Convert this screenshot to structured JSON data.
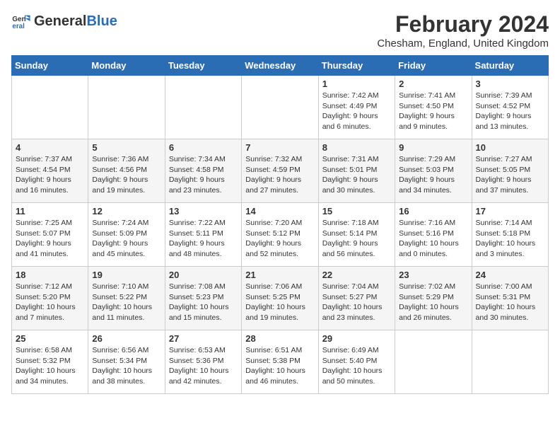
{
  "header": {
    "logo_general": "General",
    "logo_blue": "Blue",
    "month_year": "February 2024",
    "location": "Chesham, England, United Kingdom"
  },
  "days_of_week": [
    "Sunday",
    "Monday",
    "Tuesday",
    "Wednesday",
    "Thursday",
    "Friday",
    "Saturday"
  ],
  "weeks": [
    [
      {
        "day": "",
        "info": ""
      },
      {
        "day": "",
        "info": ""
      },
      {
        "day": "",
        "info": ""
      },
      {
        "day": "",
        "info": ""
      },
      {
        "day": "1",
        "info": "Sunrise: 7:42 AM\nSunset: 4:49 PM\nDaylight: 9 hours\nand 6 minutes."
      },
      {
        "day": "2",
        "info": "Sunrise: 7:41 AM\nSunset: 4:50 PM\nDaylight: 9 hours\nand 9 minutes."
      },
      {
        "day": "3",
        "info": "Sunrise: 7:39 AM\nSunset: 4:52 PM\nDaylight: 9 hours\nand 13 minutes."
      }
    ],
    [
      {
        "day": "4",
        "info": "Sunrise: 7:37 AM\nSunset: 4:54 PM\nDaylight: 9 hours\nand 16 minutes."
      },
      {
        "day": "5",
        "info": "Sunrise: 7:36 AM\nSunset: 4:56 PM\nDaylight: 9 hours\nand 19 minutes."
      },
      {
        "day": "6",
        "info": "Sunrise: 7:34 AM\nSunset: 4:58 PM\nDaylight: 9 hours\nand 23 minutes."
      },
      {
        "day": "7",
        "info": "Sunrise: 7:32 AM\nSunset: 4:59 PM\nDaylight: 9 hours\nand 27 minutes."
      },
      {
        "day": "8",
        "info": "Sunrise: 7:31 AM\nSunset: 5:01 PM\nDaylight: 9 hours\nand 30 minutes."
      },
      {
        "day": "9",
        "info": "Sunrise: 7:29 AM\nSunset: 5:03 PM\nDaylight: 9 hours\nand 34 minutes."
      },
      {
        "day": "10",
        "info": "Sunrise: 7:27 AM\nSunset: 5:05 PM\nDaylight: 9 hours\nand 37 minutes."
      }
    ],
    [
      {
        "day": "11",
        "info": "Sunrise: 7:25 AM\nSunset: 5:07 PM\nDaylight: 9 hours\nand 41 minutes."
      },
      {
        "day": "12",
        "info": "Sunrise: 7:24 AM\nSunset: 5:09 PM\nDaylight: 9 hours\nand 45 minutes."
      },
      {
        "day": "13",
        "info": "Sunrise: 7:22 AM\nSunset: 5:11 PM\nDaylight: 9 hours\nand 48 minutes."
      },
      {
        "day": "14",
        "info": "Sunrise: 7:20 AM\nSunset: 5:12 PM\nDaylight: 9 hours\nand 52 minutes."
      },
      {
        "day": "15",
        "info": "Sunrise: 7:18 AM\nSunset: 5:14 PM\nDaylight: 9 hours\nand 56 minutes."
      },
      {
        "day": "16",
        "info": "Sunrise: 7:16 AM\nSunset: 5:16 PM\nDaylight: 10 hours\nand 0 minutes."
      },
      {
        "day": "17",
        "info": "Sunrise: 7:14 AM\nSunset: 5:18 PM\nDaylight: 10 hours\nand 3 minutes."
      }
    ],
    [
      {
        "day": "18",
        "info": "Sunrise: 7:12 AM\nSunset: 5:20 PM\nDaylight: 10 hours\nand 7 minutes."
      },
      {
        "day": "19",
        "info": "Sunrise: 7:10 AM\nSunset: 5:22 PM\nDaylight: 10 hours\nand 11 minutes."
      },
      {
        "day": "20",
        "info": "Sunrise: 7:08 AM\nSunset: 5:23 PM\nDaylight: 10 hours\nand 15 minutes."
      },
      {
        "day": "21",
        "info": "Sunrise: 7:06 AM\nSunset: 5:25 PM\nDaylight: 10 hours\nand 19 minutes."
      },
      {
        "day": "22",
        "info": "Sunrise: 7:04 AM\nSunset: 5:27 PM\nDaylight: 10 hours\nand 23 minutes."
      },
      {
        "day": "23",
        "info": "Sunrise: 7:02 AM\nSunset: 5:29 PM\nDaylight: 10 hours\nand 26 minutes."
      },
      {
        "day": "24",
        "info": "Sunrise: 7:00 AM\nSunset: 5:31 PM\nDaylight: 10 hours\nand 30 minutes."
      }
    ],
    [
      {
        "day": "25",
        "info": "Sunrise: 6:58 AM\nSunset: 5:32 PM\nDaylight: 10 hours\nand 34 minutes."
      },
      {
        "day": "26",
        "info": "Sunrise: 6:56 AM\nSunset: 5:34 PM\nDaylight: 10 hours\nand 38 minutes."
      },
      {
        "day": "27",
        "info": "Sunrise: 6:53 AM\nSunset: 5:36 PM\nDaylight: 10 hours\nand 42 minutes."
      },
      {
        "day": "28",
        "info": "Sunrise: 6:51 AM\nSunset: 5:38 PM\nDaylight: 10 hours\nand 46 minutes."
      },
      {
        "day": "29",
        "info": "Sunrise: 6:49 AM\nSunset: 5:40 PM\nDaylight: 10 hours\nand 50 minutes."
      },
      {
        "day": "",
        "info": ""
      },
      {
        "day": "",
        "info": ""
      }
    ]
  ]
}
